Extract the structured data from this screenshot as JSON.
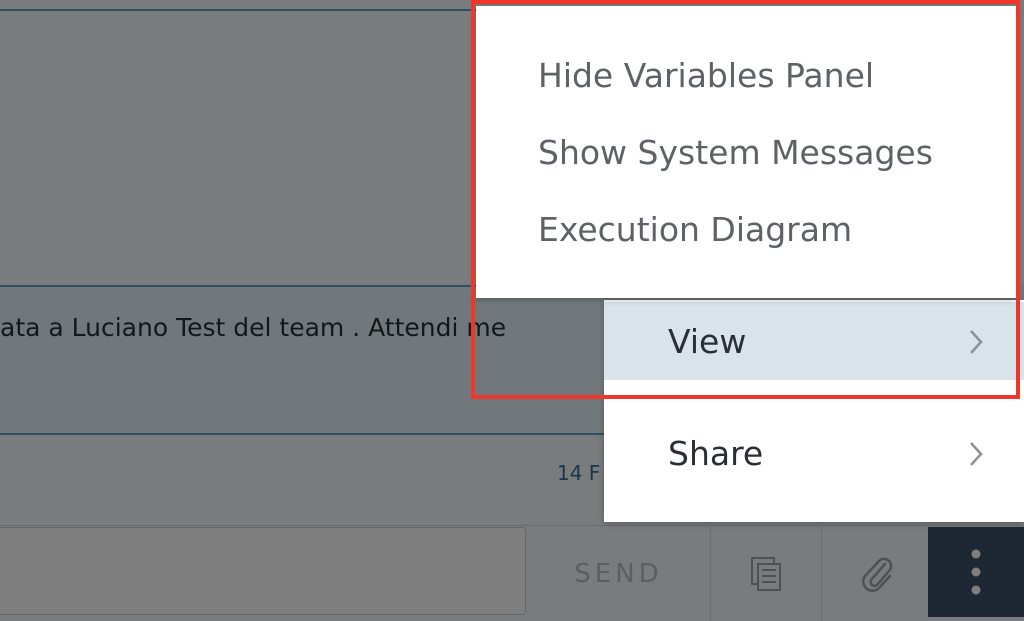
{
  "message": {
    "text": "ata a Luciano Test del team . Attendi me",
    "timestamp": "14 F"
  },
  "composer": {
    "input_placeholder": "",
    "send_label": "SEND",
    "copy_icon": "copy-icon",
    "attach_icon": "paperclip-icon",
    "more_icon": "more-vertical-icon"
  },
  "menu": {
    "items": [
      {
        "label": "View",
        "icon": "chevron-right-icon",
        "active": true
      },
      {
        "label": "Share",
        "icon": "chevron-right-icon",
        "active": false
      }
    ]
  },
  "view_submenu": {
    "items": [
      {
        "label": "Hide Variables Panel"
      },
      {
        "label": "Show System Messages"
      },
      {
        "label": "Execution Diagram"
      }
    ]
  },
  "colors": {
    "highlight": "#f0352b",
    "accent": "#5aa3c8",
    "more_button": "#3a5068"
  }
}
